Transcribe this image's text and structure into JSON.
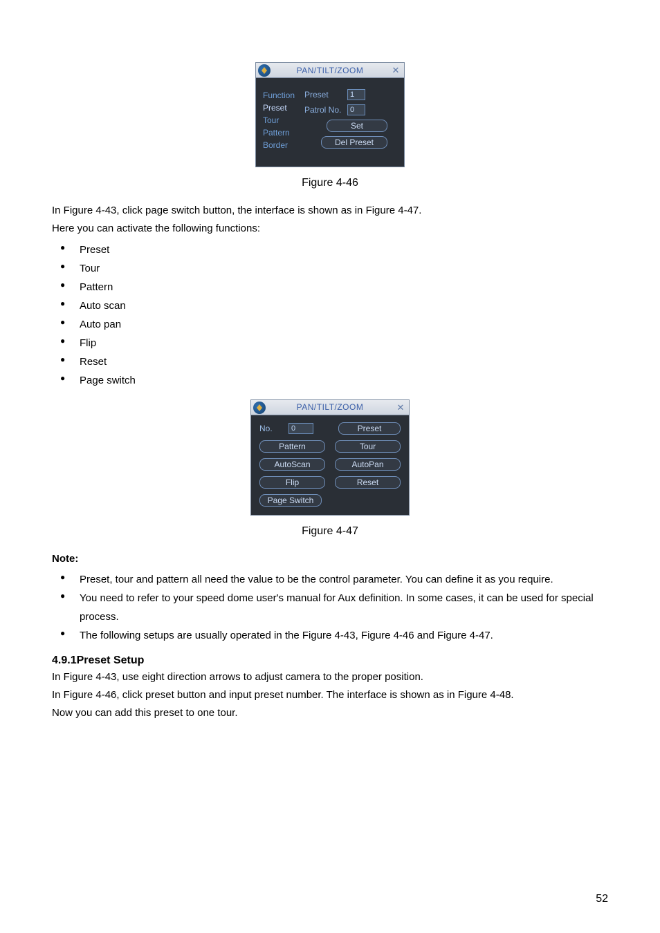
{
  "page_number": "52",
  "dialog1": {
    "title": "PAN/TILT/ZOOM",
    "func_label": "Function",
    "func_items": [
      "Preset",
      "Tour",
      "Pattern",
      "Border"
    ],
    "preset_label": "Preset",
    "preset_value": "1",
    "patrol_label": "Patrol No.",
    "patrol_value": "0",
    "set_btn": "Set",
    "del_btn": "Del Preset"
  },
  "caption1": "Figure 4-46",
  "para1_a": "In  Figure 4-43, click page switch button, the interface is shown as in Figure 4-47.",
  "para1_b": "Here you can activate the following functions:",
  "list1": [
    "Preset",
    "Tour",
    "Pattern",
    "Auto scan",
    "Auto pan",
    "Flip",
    "Reset",
    "Page switch"
  ],
  "dialog2": {
    "title": "PAN/TILT/ZOOM",
    "no_label": "No.",
    "no_value": "0",
    "preset_btn": "Preset",
    "pattern_btn": "Pattern",
    "tour_btn": "Tour",
    "autoscan_btn": "AutoScan",
    "autopan_btn": "AutoPan",
    "flip_btn": "Flip",
    "reset_btn": "Reset",
    "pageswitch_btn": "Page Switch"
  },
  "caption2": "Figure 4-47",
  "note_label": "Note:",
  "notes": [
    "Preset, tour and pattern all need the value to be the control parameter. You can define it as you require.",
    "You need to refer to your speed dome user's manual for Aux definition. In some cases, it can be used for special process.",
    "The following setups are usually operated in the Figure 4-43, Figure 4-46 and Figure 4-47."
  ],
  "section_heading": "4.9.1Preset Setup",
  "para2_a": "In Figure 4-43, use eight direction arrows to adjust camera to the proper position.",
  "para2_b": "In Figure 4-46, click preset button and input preset number. The interface is shown as in Figure 4-48.",
  "para2_c": "Now you can add this preset to one tour."
}
